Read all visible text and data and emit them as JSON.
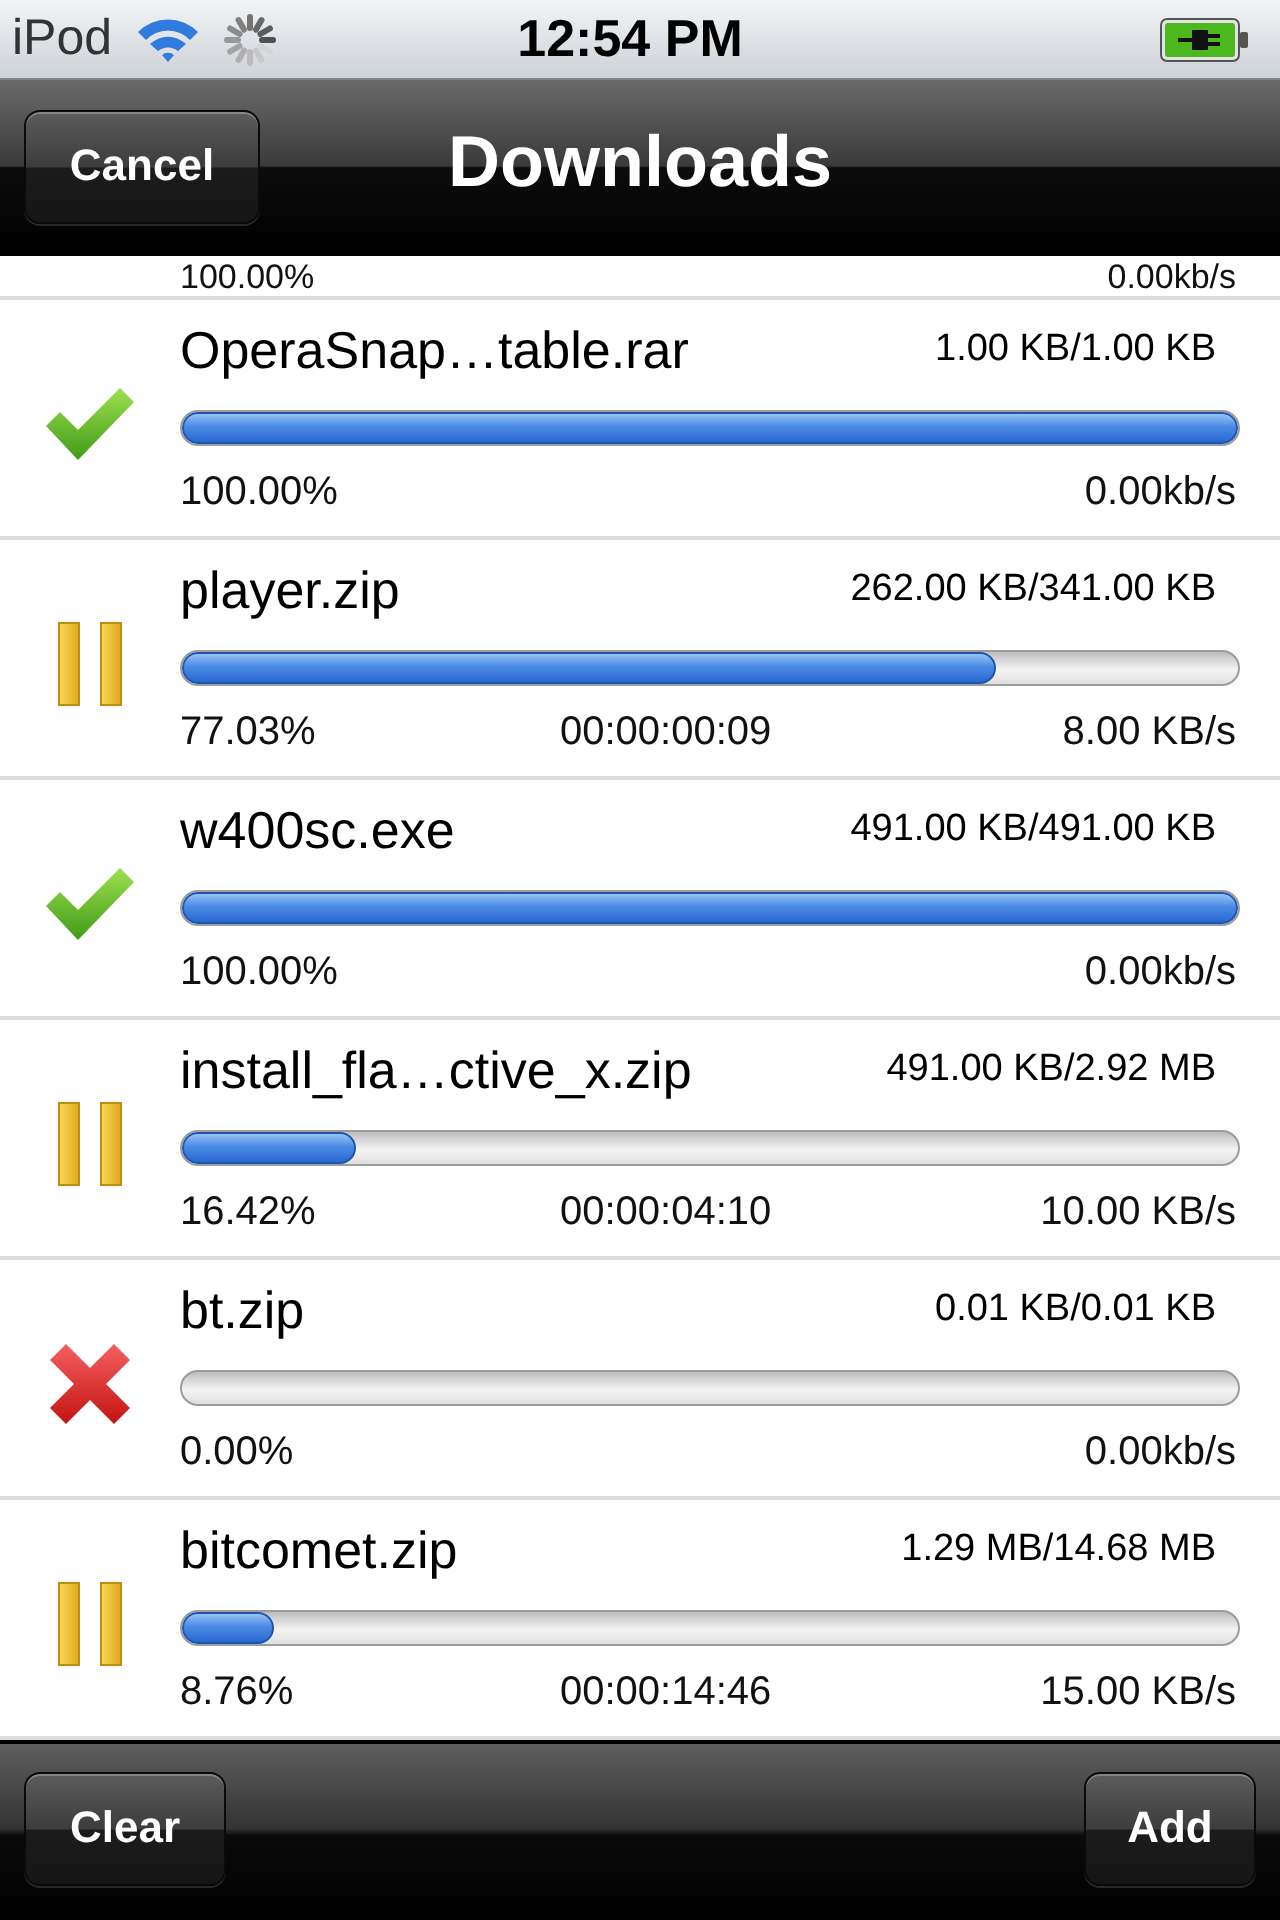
{
  "status_bar": {
    "carrier": "iPod",
    "time": "12:54 PM"
  },
  "nav_bar": {
    "cancel_button": "Cancel",
    "title": "Downloads"
  },
  "partial_row": {
    "percent": "100.00%",
    "speed": "0.00kb/s"
  },
  "downloads": [
    {
      "kind": "done",
      "name": "OperaSnap…table.rar",
      "size": "1.00 KB/1.00 KB",
      "level": 1,
      "percent": "100.00%",
      "speed": "0.00kb/s"
    },
    {
      "kind": "paused",
      "name": "player.zip",
      "size": "262.00 KB/341.00 KB",
      "level": 0.7703,
      "percent": "77.03%",
      "time_left": "00:00:00:09",
      "speed": "8.00 KB/s"
    },
    {
      "kind": "done",
      "name": "w400sc.exe",
      "size": "491.00 KB/491.00 KB",
      "level": 1,
      "percent": "100.00%",
      "speed": "0.00kb/s"
    },
    {
      "kind": "paused",
      "name": "install_fla…ctive_x.zip",
      "size": "491.00 KB/2.92 MB",
      "level": 0.1642,
      "percent": "16.42%",
      "time_left": "00:00:04:10",
      "speed": "10.00 KB/s"
    },
    {
      "kind": "failed",
      "name": "bt.zip",
      "size": "0.01 KB/0.01 KB",
      "percent": "0.00%",
      "speed": "0.00kb/s"
    },
    {
      "kind": "paused",
      "name": "bitcomet.zip",
      "size": "1.29 MB/14.68 MB",
      "level": 0.0876,
      "percent": "8.76%",
      "time_left": "00:00:14:46",
      "speed": "15.00 KB/s"
    }
  ],
  "toolbar": {
    "left_button": "Clear",
    "right_button": "Add"
  }
}
